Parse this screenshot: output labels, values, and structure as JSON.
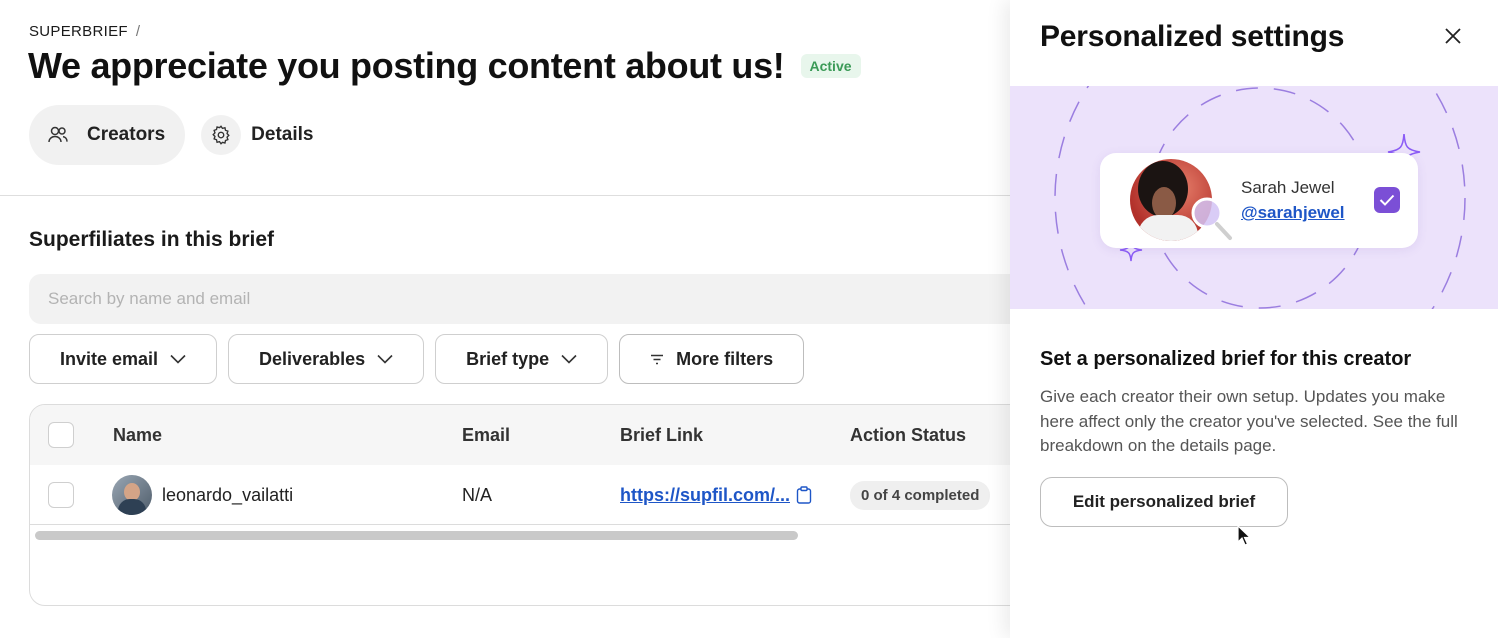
{
  "brief": {
    "breadcrumb": "SUPERBRIEF",
    "separator": "/",
    "title": "We appreciate you posting content about us!",
    "status": "Active"
  },
  "tabs": [
    {
      "label": "Creators",
      "icon": "users-icon",
      "active": true
    },
    {
      "label": "Details",
      "icon": "gear-icon",
      "active": false
    }
  ],
  "section_title": "Superfiliates in this brief",
  "search": {
    "placeholder": "Search by name and email",
    "value": ""
  },
  "filters": {
    "invite_email": "Invite email",
    "deliverables": "Deliverables",
    "brief_type": "Brief type",
    "more_filters": "More filters"
  },
  "table": {
    "columns": {
      "name": "Name",
      "email": "Email",
      "brief_link": "Brief Link",
      "action_status": "Action Status"
    },
    "rows": [
      {
        "name": "leonardo_vailatti",
        "email": "N/A",
        "brief_link": "https://supfil.com/...",
        "action_status": "0 of 4 completed"
      }
    ]
  },
  "panel": {
    "title": "Personalized settings",
    "creator_name": "Sarah Jewel",
    "creator_handle": "@sarahjewel",
    "heading": "Set a personalized brief for this creator",
    "description": "Give each creator their own setup. Updates you make here affect only the creator you've selected. See the full breakdown on the details page.",
    "edit_button": "Edit personalized brief"
  },
  "colors": {
    "accent_purple": "#7b4fd6",
    "hero_bg": "#ece2fb",
    "link_blue": "#1e56c7",
    "active_green": "#3b9a57"
  }
}
